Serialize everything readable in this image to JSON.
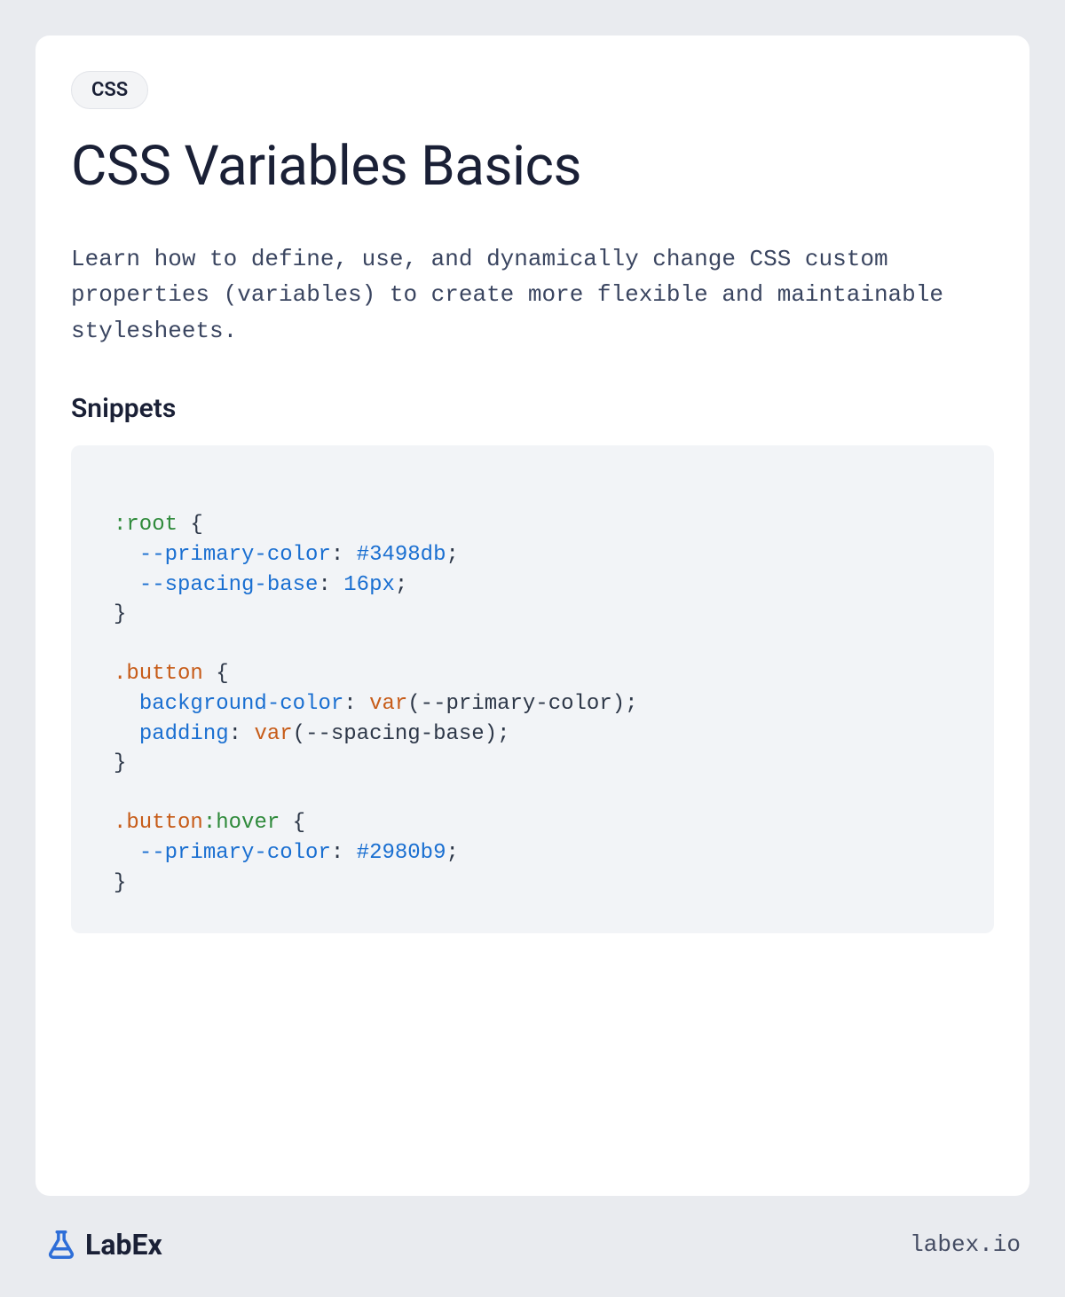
{
  "tag": "CSS",
  "title": "CSS Variables Basics",
  "description": "Learn how to define, use, and dynamically change CSS custom properties (variables) to create more flexible and maintainable stylesheets.",
  "sectionHeading": "Snippets",
  "code": {
    "root_selector": ":root",
    "prop1_name": "--primary-color",
    "prop1_value": "#3498db",
    "prop2_name": "--spacing-base",
    "prop2_value": "16px",
    "button_selector": ".button",
    "bg_prop": "background-color",
    "var_func1": "var",
    "var_arg1": "(--primary-color)",
    "padding_prop": "padding",
    "var_func2": "var",
    "var_arg2": "(--spacing-base)",
    "button_hover_sel": ".button",
    "hover_pseudo": ":hover",
    "hover_prop": "--primary-color",
    "hover_value": "#2980b9"
  },
  "footer": {
    "brand": "LabEx",
    "domain": "labex.io"
  }
}
